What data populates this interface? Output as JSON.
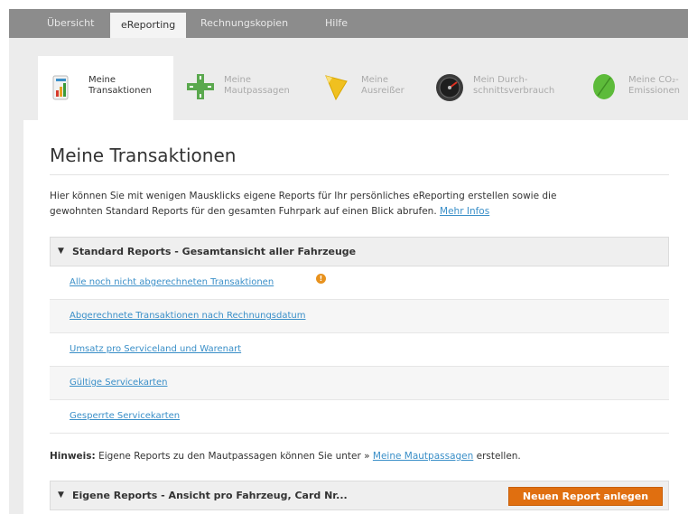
{
  "top_nav": {
    "tabs": [
      {
        "label": "Übersicht",
        "active": false
      },
      {
        "label": "eReporting",
        "active": true
      },
      {
        "label": "Rechnungskopien",
        "active": false
      },
      {
        "label": "Hilfe",
        "active": false
      }
    ]
  },
  "icon_tabs": [
    {
      "label": "Meine\nTransaktionen",
      "icon": "bar-chart-icon",
      "active": true
    },
    {
      "label": "Meine\nMautpassagen",
      "icon": "road-icon",
      "active": false
    },
    {
      "label": "Meine\nAusreißer",
      "icon": "megaphone-icon",
      "active": false
    },
    {
      "label": "Mein Durch-\nschnittsverbrauch",
      "icon": "speedometer-icon",
      "active": false
    },
    {
      "label": "Meine CO₂-\nEmissionen",
      "icon": "leaf-icon",
      "active": false
    }
  ],
  "page": {
    "title": "Meine Transaktionen",
    "intro_line1": "Hier können Sie mit wenigen Mausklicks eigene Reports für Ihr persönliches eReporting erstellen sowie die",
    "intro_line2": "gewohnten Standard Reports für den gesamten Fuhrpark auf einen Blick abrufen.",
    "more_info_link": "Mehr Infos"
  },
  "standard_reports": {
    "header": "Standard Reports - Gesamtansicht aller Fahrzeuge",
    "items": [
      "Alle noch nicht abgerechneten Transaktionen",
      "Abgerechnete Transaktionen nach Rechnungsdatum",
      "Umsatz pro Serviceland und Warenart",
      "Gültige Servicekarten",
      "Gesperrte Servicekarten"
    ],
    "info_badge": "!"
  },
  "hint": {
    "label": "Hinweis:",
    "text": "Eigene Reports zu den Mautpassagen können Sie unter »",
    "link": "Meine Mautpassagen",
    "suffix": "erstellen."
  },
  "own_reports": {
    "header": "Eigene Reports - Ansicht pro Fahrzeug, Card Nr...",
    "new_button": "Neuen Report anlegen"
  },
  "colors": {
    "accent_orange": "#e06f10",
    "link_blue": "#3a8fc8",
    "nav_gray": "#8c8c8c"
  }
}
